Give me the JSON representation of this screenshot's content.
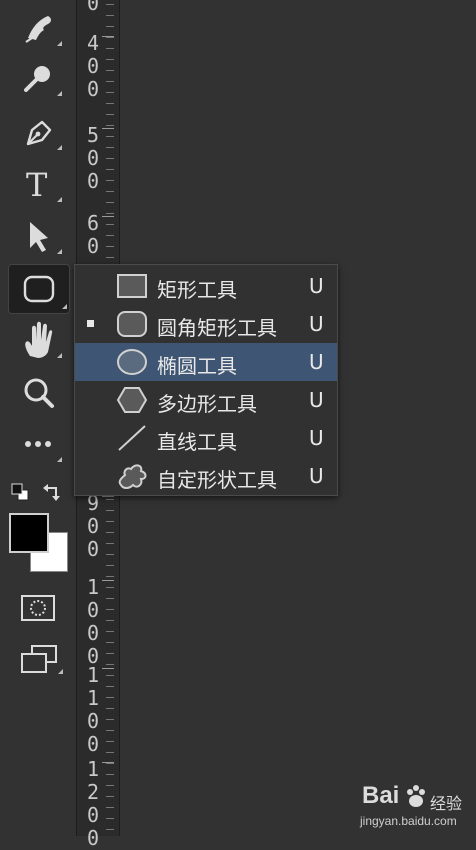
{
  "ruler": {
    "groups": [
      {
        "digits": "0"
      },
      {
        "digits": "400"
      },
      {
        "digits": "500"
      },
      {
        "digits": "60"
      },
      {
        "digits": "900"
      },
      {
        "digits": "1000"
      },
      {
        "digits": "1100"
      },
      {
        "digits": "1200"
      }
    ]
  },
  "toolbar": {
    "tools": [
      {
        "name": "history-brush-icon"
      },
      {
        "name": "dodge-icon"
      },
      {
        "name": "pen-icon"
      },
      {
        "name": "type-icon",
        "glyph": "T"
      },
      {
        "name": "path-selection-icon"
      },
      {
        "name": "rounded-rectangle-icon",
        "selected": true
      },
      {
        "name": "hand-icon"
      },
      {
        "name": "zoom-icon"
      },
      {
        "name": "more-tools-icon",
        "glyph": "•••"
      }
    ],
    "foreground_color": "#000000",
    "background_color": "#ffffff"
  },
  "menu": {
    "items": [
      {
        "label": "矩形工具",
        "shortcut": "U",
        "icon": "rectangle-icon",
        "active": false,
        "highlighted": false
      },
      {
        "label": "圆角矩形工具",
        "shortcut": "U",
        "icon": "rounded-rectangle-icon",
        "active": true,
        "highlighted": false
      },
      {
        "label": "椭圆工具",
        "shortcut": "U",
        "icon": "ellipse-icon",
        "active": false,
        "highlighted": true
      },
      {
        "label": "多边形工具",
        "shortcut": "U",
        "icon": "polygon-icon",
        "active": false,
        "highlighted": false
      },
      {
        "label": "直线工具",
        "shortcut": "U",
        "icon": "line-icon",
        "active": false,
        "highlighted": false
      },
      {
        "label": "自定形状工具",
        "shortcut": "U",
        "icon": "custom-shape-icon",
        "active": false,
        "highlighted": false
      }
    ],
    "highlight_color": "#3e5573"
  },
  "watermark": {
    "logo": "Bai",
    "logo_suffix": "经验",
    "url": "jingyan.baidu.com"
  }
}
